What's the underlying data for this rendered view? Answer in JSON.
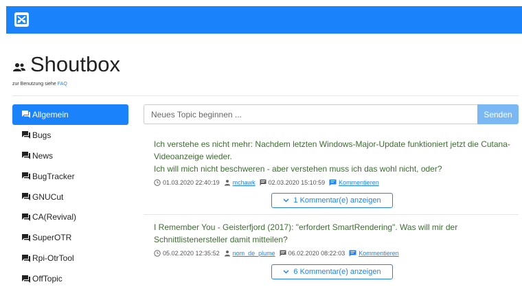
{
  "header": {
    "logo_icon": "app-logo-icon",
    "color": "#1a82fb"
  },
  "page": {
    "title": "Shoutbox",
    "title_icon": "people-icon",
    "subtitle_prefix": "zur Benutzung siehe",
    "subtitle_link": "FAQ"
  },
  "sidebar": {
    "items": [
      {
        "label": "Allgemein",
        "active": true
      },
      {
        "label": "Bugs"
      },
      {
        "label": "News"
      },
      {
        "label": "BugTracker"
      },
      {
        "label": "GNUCut"
      },
      {
        "label": "CA(Revival)"
      },
      {
        "label": "SuperOTR"
      },
      {
        "label": "Rpi-OtrTool"
      },
      {
        "label": "OffTopic"
      }
    ]
  },
  "composer": {
    "placeholder": "Neues Topic beginnen ...",
    "send_label": "Senden"
  },
  "topics": [
    {
      "text_line1": "Ich verstehe es nicht mehr: Nachdem letzten Windows-Major-Update funktioniert jetzt die Cutana-Videoanzeige wieder.",
      "text_line2": "Ich will mich nicht beschweren - aber verstehen muss ich das wohl nicht, oder?",
      "created": "01.03.2020 22:40:19",
      "author": "mchawk",
      "last_comment": "02.03.2020 15:10:59",
      "comment_label": "Kommentieren",
      "expand_label": "1 Kommentar(e) anzeigen"
    },
    {
      "text_line1": "I Remember You - Geisterfjord (2017): \"erfordert SmartRendering\". Was will mir der Schnittlistenersteller damit mitteilen?",
      "created": "05.02.2020 12:35:52",
      "author": "nom_de_plume",
      "last_comment": "06.02.2020 08:22:03",
      "comment_label": "Kommentieren",
      "expand_label": "6 Kommentar(e) anzeigen"
    }
  ]
}
